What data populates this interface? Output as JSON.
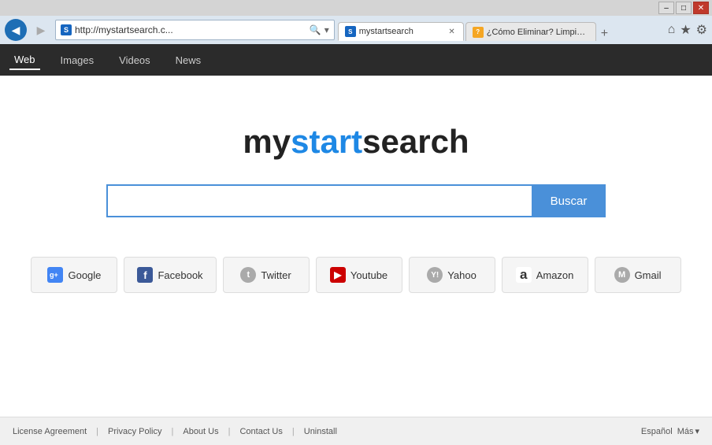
{
  "window": {
    "title_bar": {
      "minimize_label": "–",
      "maximize_label": "□",
      "close_label": "✕"
    }
  },
  "navbar": {
    "back_icon": "◀",
    "forward_icon": "▶",
    "address": "http://mystartsearch.c...",
    "search_placeholder": "",
    "address_tab_label": "mystartsearch",
    "second_tab_label": "¿Cómo Eliminar? Limpiar su co...",
    "home_icon": "⌂",
    "star_icon": "★",
    "gear_icon": "⚙"
  },
  "search_toolbar": {
    "tabs": [
      {
        "label": "Web",
        "active": true
      },
      {
        "label": "Images",
        "active": false
      },
      {
        "label": "Videos",
        "active": false
      },
      {
        "label": "News",
        "active": false
      }
    ]
  },
  "main": {
    "logo": {
      "my": "my",
      "start": "start",
      "search": "search"
    },
    "search_input_placeholder": "",
    "search_button_label": "Buscar"
  },
  "quick_links": [
    {
      "id": "google",
      "label": "Google",
      "icon_type": "google",
      "icon_text": "g+"
    },
    {
      "id": "facebook",
      "label": "Facebook",
      "icon_type": "facebook",
      "icon_text": "f"
    },
    {
      "id": "twitter",
      "label": "Twitter",
      "icon_type": "twitter",
      "icon_text": "t"
    },
    {
      "id": "youtube",
      "label": "Youtube",
      "icon_type": "youtube",
      "icon_text": "▶"
    },
    {
      "id": "yahoo",
      "label": "Yahoo",
      "icon_type": "yahoo",
      "icon_text": "Y!"
    },
    {
      "id": "amazon",
      "label": "Amazon",
      "icon_type": "amazon",
      "icon_text": "a"
    },
    {
      "id": "gmail",
      "label": "Gmail",
      "icon_type": "gmail",
      "icon_text": "M"
    }
  ],
  "footer": {
    "links": [
      {
        "label": "License Agreement"
      },
      {
        "label": "Privacy Policy"
      },
      {
        "label": "About Us"
      },
      {
        "label": "Contact Us"
      },
      {
        "label": "Uninstall"
      }
    ],
    "lang": "Español",
    "more": "Más"
  }
}
